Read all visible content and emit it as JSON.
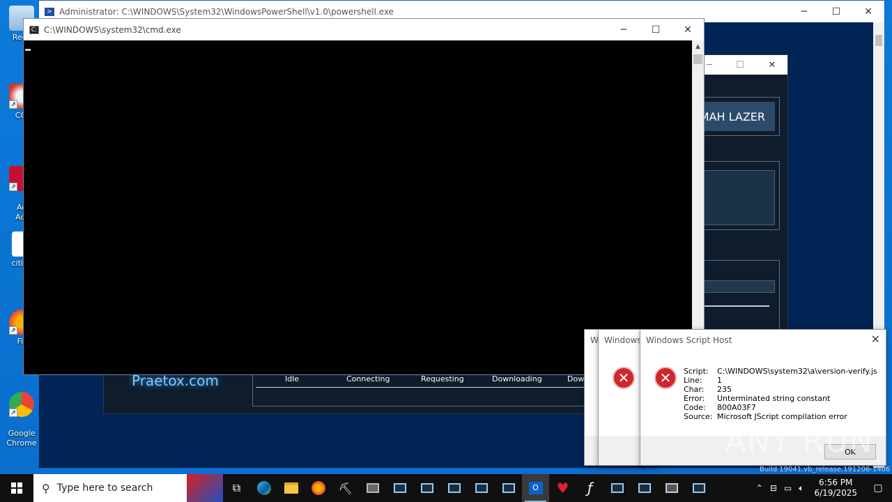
{
  "desktop_icons": [
    {
      "label": "Recy",
      "icon": "recycle-bin-icon"
    },
    {
      "label": "CCl",
      "icon": "ccleaner-icon"
    },
    {
      "label": "Ad\nAcr",
      "icon": "acrobat-icon"
    },
    {
      "label": "cities",
      "icon": "file-icon"
    },
    {
      "label": "Fir",
      "icon": "firefox-icon"
    },
    {
      "label": "Google\nChrome",
      "icon": "chrome-icon"
    }
  ],
  "powershell": {
    "title": "Administrator: C:\\WINDOWS\\System32\\WindowsPowerShell\\v1.0\\powershell.exe"
  },
  "app": {
    "button_label": "MAH LAZER",
    "brand": "Praetox.com",
    "status_labels": [
      "Idle",
      "Connecting",
      "Requesting",
      "Downloading",
      "Dow"
    ]
  },
  "cmd": {
    "title": "C:\\WINDOWS\\system32\\cmd.exe"
  },
  "wsh_stack": [
    {
      "title": "Wi"
    },
    {
      "title": "Windows"
    }
  ],
  "wsh_dialog": {
    "title": "Windows Script Host",
    "details": [
      {
        "key": "Script:",
        "value": "C:\\WINDOWS\\system32\\a\\version-verify.js"
      },
      {
        "key": "Line:",
        "value": "1"
      },
      {
        "key": "Char:",
        "value": "235"
      },
      {
        "key": "Error:",
        "value": "Unterminated string constant"
      },
      {
        "key": "Code:",
        "value": "800A03F7"
      },
      {
        "key": "Source:",
        "value": "Microsoft JScript compilation error"
      }
    ],
    "ok_label": "OK"
  },
  "watermark": "ANY RUN",
  "build_text": "Build 19041.vb_release.191206-1406",
  "taskbar": {
    "search_placeholder": "Type here to search",
    "pinned": [
      "task-view-icon",
      "edge-icon",
      "file-explorer-icon",
      "firefox-icon",
      "pickaxe-icon",
      "network-icon",
      "window-icon",
      "window-icon",
      "window-icon",
      "window-icon",
      "window-icon",
      "outlook-icon",
      "heart-icon",
      "flash-icon",
      "window-icon",
      "window-icon",
      "installer-icon",
      "window-icon"
    ],
    "time": "6:56 PM",
    "date": "6/19/2025"
  },
  "colors": {
    "desktop": "#0a74d4",
    "powershell_bg": "#012456",
    "app_bg": "#0f1c2c",
    "error_red": "#d0262c"
  }
}
